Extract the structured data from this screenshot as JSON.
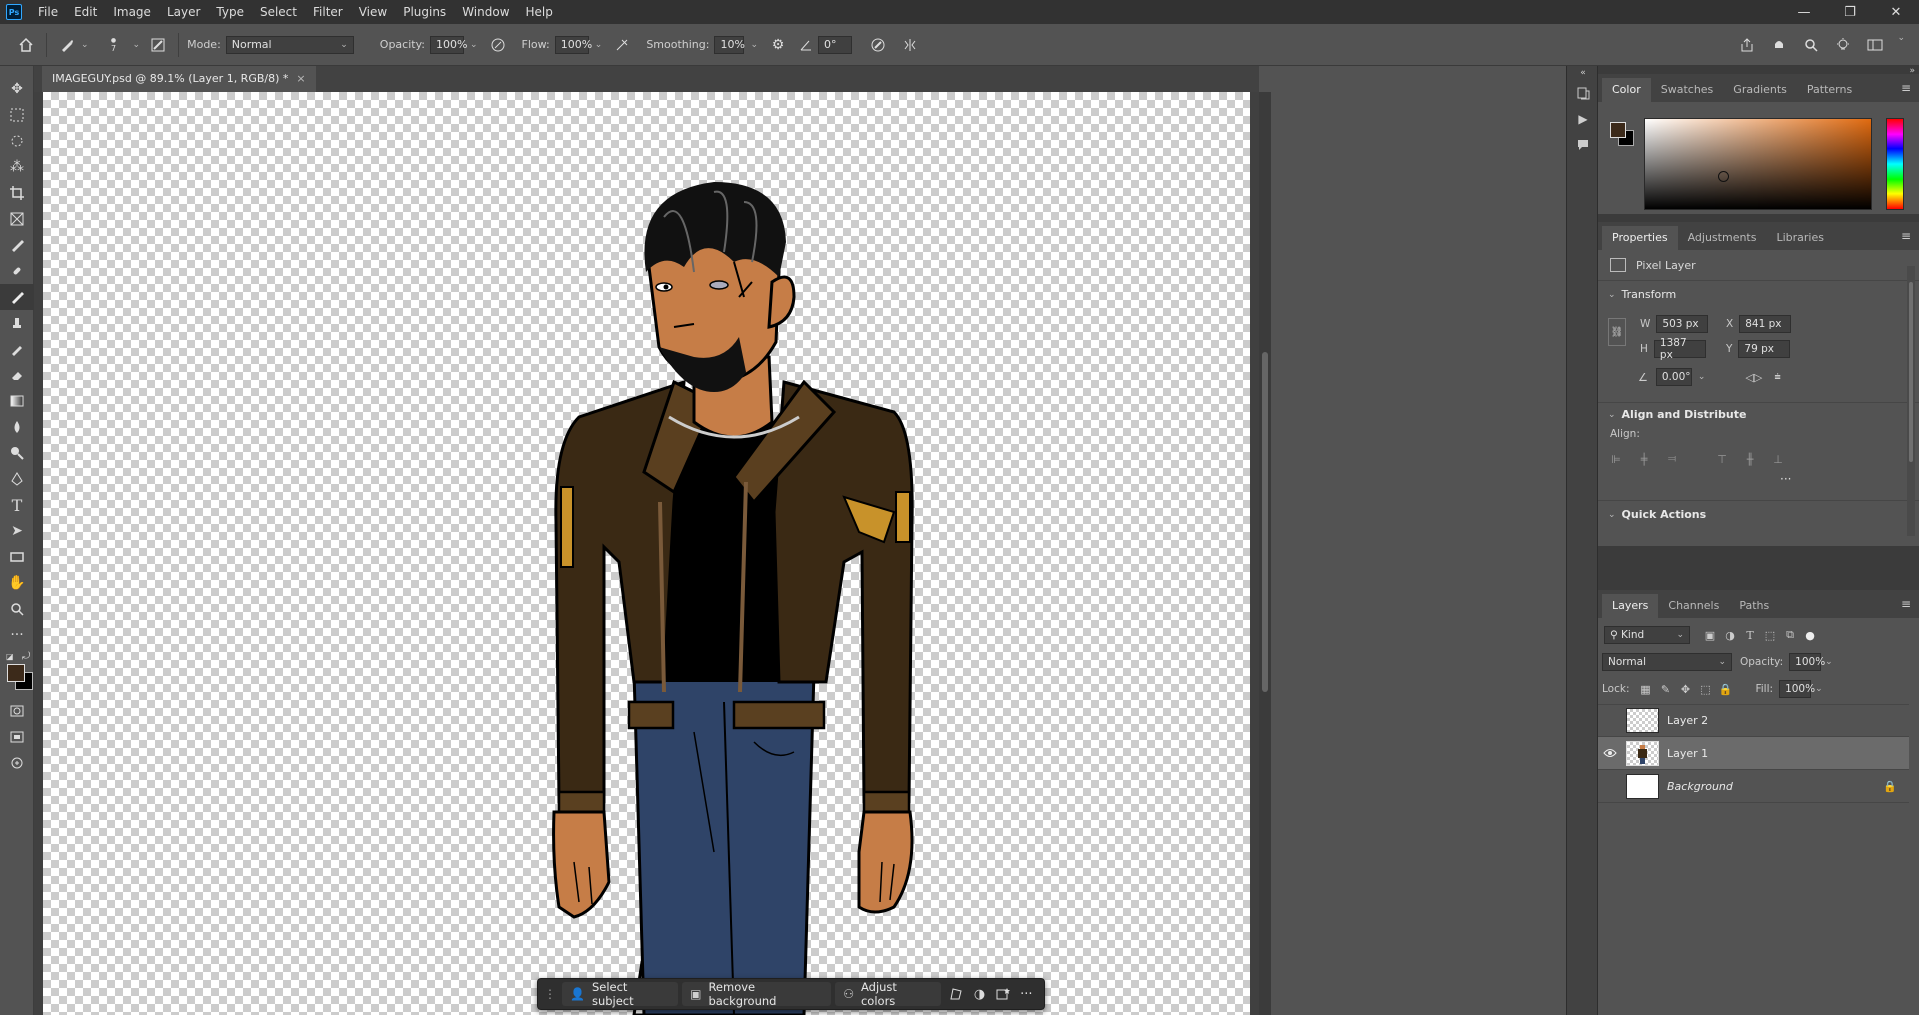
{
  "app": {
    "logo": "Ps"
  },
  "menu": [
    "File",
    "Edit",
    "Image",
    "Layer",
    "Type",
    "Select",
    "Filter",
    "View",
    "Plugins",
    "Window",
    "Help"
  ],
  "window_controls": {
    "minimize": "—",
    "restore": "❐",
    "close": "✕"
  },
  "options": {
    "brush_size": "7",
    "mode_label": "Mode:",
    "mode_value": "Normal",
    "opacity_label": "Opacity:",
    "opacity_value": "100%",
    "flow_label": "Flow:",
    "flow_value": "100%",
    "smoothing_label": "Smoothing:",
    "smoothing_value": "10%",
    "angle_value": "0°"
  },
  "document": {
    "tab_title": "IMAGEGUY.psd @ 89.1% (Layer 1, RGB/8) *"
  },
  "taskbar": {
    "select_subject": "Select subject",
    "remove_background": "Remove background",
    "adjust_colors": "Adjust colors",
    "more": "···"
  },
  "color_panel": {
    "tabs": [
      "Color",
      "Swatches",
      "Gradients",
      "Patterns"
    ],
    "foreground": "#3c2a1a",
    "background": "#000000"
  },
  "properties_panel": {
    "tabs": [
      "Properties",
      "Adjustments",
      "Libraries"
    ],
    "layer_type": "Pixel Layer",
    "transform_title": "Transform",
    "w_label": "W",
    "w_value": "503 px",
    "h_label": "H",
    "h_value": "1387 px",
    "x_label": "X",
    "x_value": "841 px",
    "y_label": "Y",
    "y_value": "79 px",
    "angle_value": "0.00°",
    "align_title": "Align and Distribute",
    "align_label": "Align:",
    "more": "···",
    "quick_actions_title": "Quick Actions"
  },
  "layers_panel": {
    "tabs": [
      "Layers",
      "Channels",
      "Paths"
    ],
    "kind_value": "Kind",
    "blend_value": "Normal",
    "opacity_label": "Opacity:",
    "opacity_value": "100%",
    "lock_label": "Lock:",
    "fill_label": "Fill:",
    "fill_value": "100%",
    "layers": [
      {
        "name": "Layer 2",
        "visible": false,
        "selected": false,
        "locked": false
      },
      {
        "name": "Layer 1",
        "visible": true,
        "selected": true,
        "locked": false
      },
      {
        "name": "Background",
        "visible": false,
        "selected": false,
        "locked": true
      }
    ]
  }
}
